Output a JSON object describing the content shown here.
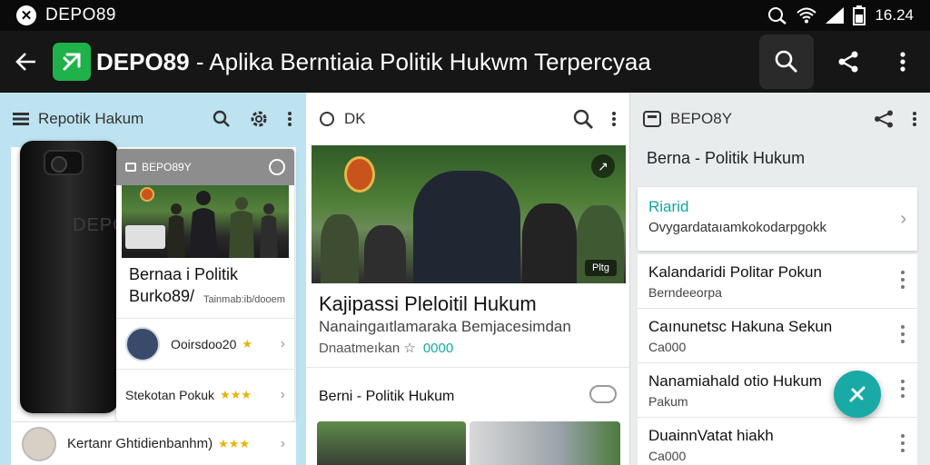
{
  "status_bar": {
    "carrier": "DEPO89",
    "time": "16.24"
  },
  "app_bar": {
    "title_bold": "DEPO89",
    "title_rest": " - Aplika  Berntiaia Politik Hukwm Terpercyaa"
  },
  "left_panel": {
    "header": "Repotik Hakum",
    "phone_brand": "DEPO",
    "card": {
      "header": "BEPO89Y",
      "title": "Bernaa i Politik\nBurko89/",
      "meta": "Tainmab:ib/dooem",
      "rows": [
        {
          "label": "Ooirsdoo20",
          "stars": "★"
        },
        {
          "label": "Stekotan Pokuk",
          "stars": "★★★"
        }
      ]
    },
    "bottom_row": "Kertanr Ghtidienbanhm)"
  },
  "mid_panel": {
    "header": "DK",
    "photo_tag": "Pltg",
    "headline": "Kajipassi Pleloitil Hukum",
    "subtitle": "Nanaingaıtlamaraka Bemjacesimdan",
    "meta": "Dnaatmeıkan ☆",
    "meta_num": "0000",
    "section": "Berni - Politik Hukum"
  },
  "right_panel": {
    "header": "BEPO8Y",
    "subheader": "Berna - Politik Hukum",
    "highlight": {
      "title": "Riarid",
      "subtitle": "Ovygardataıamkokodarpgokk"
    },
    "items": [
      {
        "title": "Kalandaridi Politar Pokun",
        "sub": "Berndeeorpa"
      },
      {
        "title": "Caınunetsc Hakuna Sekun",
        "sub": "Ca000"
      },
      {
        "title": "Nanamiahald otio Hukum",
        "sub": "Pakum"
      },
      {
        "title": "DuainnVatat hiakh",
        "sub": "Ca000"
      }
    ]
  },
  "colors": {
    "accent": "#19aaa6",
    "logo": "#1fb24a",
    "left_bg": "#bde3f0",
    "star": "#e8b400"
  }
}
